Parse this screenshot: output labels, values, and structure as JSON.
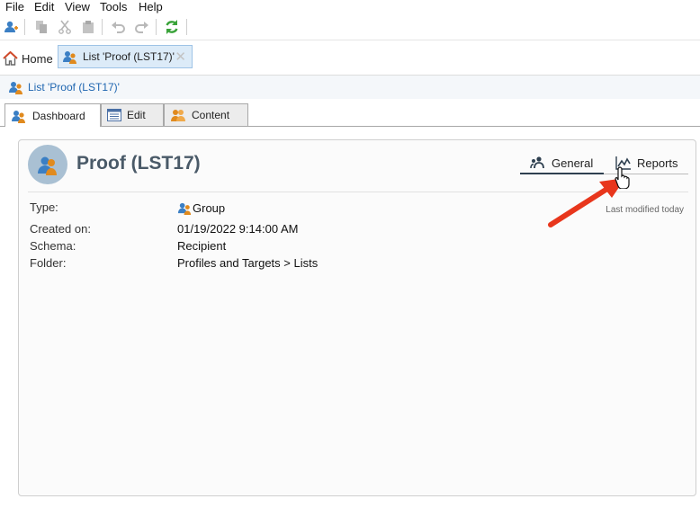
{
  "menu": {
    "file": "File",
    "edit": "Edit",
    "view": "View",
    "tools": "Tools",
    "help": "Help"
  },
  "tabs": {
    "home": "Home",
    "doc": "List 'Proof (LST17)'"
  },
  "breadcrumb": {
    "label": "List 'Proof (LST17)'"
  },
  "subtabs": {
    "dashboard": "Dashboard",
    "edit": "Edit",
    "content": "Content"
  },
  "panel": {
    "title": "Proof (LST17)",
    "view_tabs": {
      "general": "General",
      "reports": "Reports"
    },
    "last_modified": "Last modified today",
    "fields": [
      {
        "label": "Type:",
        "value": "Group"
      },
      {
        "label": "Created on:",
        "value": "01/19/2022 9:14:00 AM"
      },
      {
        "label": "Schema:",
        "value": "Recipient"
      },
      {
        "label": "Folder:",
        "value": "Profiles and Targets > Lists"
      }
    ]
  },
  "colors": {
    "accent": "#1f66b0",
    "annotation_arrow": "#e8361c",
    "refresh": "#3aa33a"
  },
  "icons": [
    "add-user-icon",
    "copy-icon",
    "cut-icon",
    "paste-icon",
    "undo-icon",
    "redo-icon",
    "refresh-icon",
    "home-icon",
    "group-icon",
    "close-icon",
    "grid-icon",
    "people-icon",
    "chart-icon",
    "hand-cursor-icon"
  ]
}
